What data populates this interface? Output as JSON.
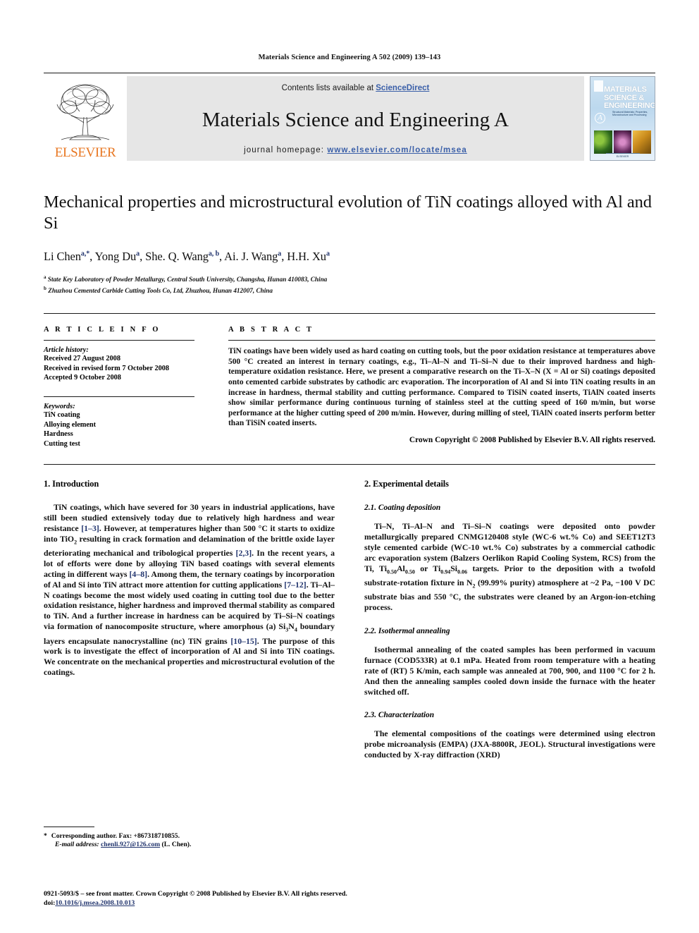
{
  "running_head": "Materials Science and Engineering A 502 (2009) 139–143",
  "banner": {
    "publisher": "ELSEVIER",
    "contents_prefix": "Contents lists available at ",
    "contents_link": "ScienceDirect",
    "journal_name": "Materials Science and Engineering A",
    "homepage_prefix": "journal homepage:",
    "homepage_url": "www.elsevier.com/locate/msea",
    "cover": {
      "line1": "MATERIALS",
      "line2": "SCIENCE &",
      "line3": "ENGINEERING",
      "series_letter": "A",
      "subtitle": "Structural Materials: Properties, Microstructure and Processing",
      "footer": "ELSEVIER"
    },
    "link_color": "#3a5fa8",
    "elsevier_orange": "#E87722"
  },
  "article": {
    "title": "Mechanical properties and microstructural evolution of TiN coatings alloyed with Al and Si",
    "authors": "Li Chen, Yong Du, She. Q. Wang, Ai. J. Wang, H.H. Xu",
    "affiliation_a": "State Key Laboratory of Powder Metallurgy, Central South University, Changsha, Hunan 410083, China",
    "affiliation_b": "Zhuzhou Cemented Carbide Cutting Tools Co, Ltd, Zhuzhou, Hunan 412007, China"
  },
  "article_info": {
    "heading": "A R T I C L E    I N F O",
    "history_label": "Article history:",
    "history": [
      "Received 27 August 2008",
      "Received in revised form 7 October 2008",
      "Accepted 9 October 2008"
    ],
    "keywords_label": "Keywords:",
    "keywords": [
      "TiN coating",
      "Alloying element",
      "Hardness",
      "Cutting test"
    ]
  },
  "abstract": {
    "heading": "A B S T R A C T",
    "text": "TiN coatings have been widely used as hard coating on cutting tools, but the poor oxidation resistance at temperatures above 500 °C created an interest in ternary coatings, e.g., Ti–Al–N and Ti–Si–N due to their improved hardness and high-temperature oxidation resistance. Here, we present a comparative research on the Ti–X–N (X = Al or Si) coatings deposited onto cemented carbide substrates by cathodic arc evaporation. The incorporation of Al and Si into TiN coating results in an increase in hardness, thermal stability and cutting performance. Compared to TiSiN coated inserts, TiAlN coated inserts show similar performance during continuous turning of stainless steel at the cutting speed of 160 m/min, but worse performance at the higher cutting speed of 200 m/min. However, during milling of steel, TiAlN coated inserts perform better than TiSiN coated inserts.",
    "copyright": "Crown Copyright © 2008 Published by Elsevier B.V. All rights reserved."
  },
  "sections": {
    "introduction": {
      "heading": "1.  Introduction",
      "paragraph_1": "TiN coatings, which have severed for 30 years in industrial applications, have still been studied extensively today due to relatively high hardness and wear resistance [1–3]. However, at temperatures higher than 500 °C it starts to oxidize into TiO2 resulting in crack formation and delamination of the brittle oxide layer deteriorating mechanical and tribological properties [2,3]. In the recent years, a lot of efforts were done by alloying TiN based coatings with several elements acting in different ways [4–8]. Among them, the ternary coatings by incorporation of Al and Si into TiN attract more attention for cutting applications [7–12]. Ti–Al–N coatings become the most widely used coating in cutting tool due to the better oxidation resistance, higher hardness and improved thermal stability as compared to TiN. And a further increase in hardness can be acquired by Ti–Si–N coatings via formation of nanocomposite structure, where amorphous (a) Si3N4 boundary layers encapsulate nanocrystalline (nc) TiN grains [10–15]. The purpose of this work is to investigate the effect of incorporation of Al and Si into TiN coatings. We concentrate on the mechanical properties and microstructural evolution of the coatings."
    },
    "experimental": {
      "heading": "2.  Experimental details",
      "sub_1": {
        "heading": "2.1.  Coating deposition",
        "paragraph": "Ti–N, Ti–Al–N and Ti–Si–N coatings were deposited onto powder metallurgically prepared CNMG120408 style (WC-6 wt.% Co) and SEET12T3 style cemented carbide (WC-10 wt.% Co) substrates by a commercial cathodic arc evaporation system (Balzers Oerlikon Rapid Cooling System, RCS) from the Ti, Ti0.50Al0.50 or Ti0.94Si0.06 targets. Prior to the deposition with a twofold substrate-rotation fixture in N2 (99.99% purity) atmosphere at ~2 Pa, −100 V DC substrate bias and 550 °C, the substrates were cleaned by an Argon-ion-etching process."
      },
      "sub_2": {
        "heading": "2.2.  Isothermal annealing",
        "paragraph": "Isothermal annealing of the coated samples has been performed in vacuum furnace (COD533R) at 0.1 mPa. Heated from room temperature with a heating rate of (RT) 5 K/min, each sample was annealed at 700, 900, and 1100 °C for 2 h. And then the annealing samples cooled down inside the furnace with the heater switched off."
      },
      "sub_3": {
        "heading": "2.3.  Characterization",
        "paragraph": "The elemental compositions of the coatings were determined using electron probe microanalysis (EMPA) (JXA-8800R, JEOL). Structural investigations were conducted by X-ray diffraction (XRD)"
      }
    }
  },
  "footnote": {
    "star": "*",
    "corresponding": "Corresponding author. Fax: +867318710855.",
    "email_label": "E-mail address:",
    "email": "chenli.927@126.com",
    "email_suffix": "(L. Chen)."
  },
  "bottom": {
    "copyright": "0921-5093/$ – see front matter. Crown Copyright © 2008 Published by Elsevier B.V. All rights reserved.",
    "doi_label": "doi:",
    "doi": "10.1016/j.msea.2008.10.013"
  }
}
